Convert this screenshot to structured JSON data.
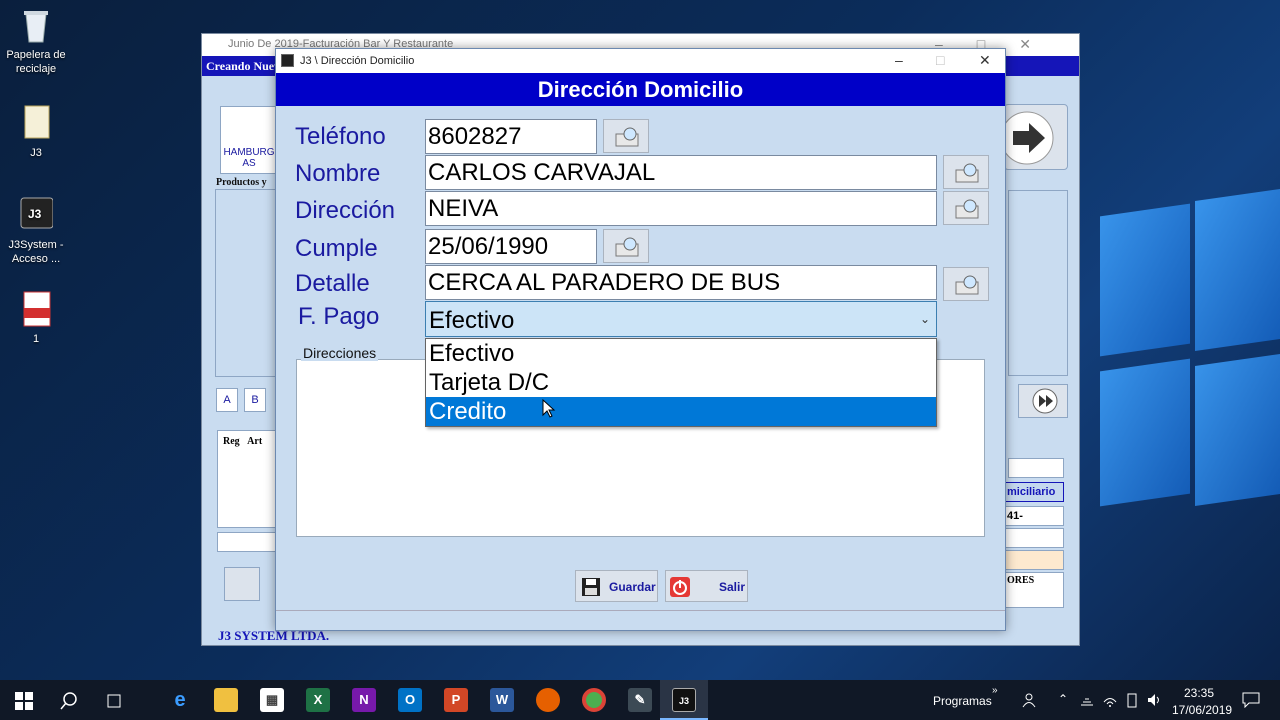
{
  "desktop": {
    "icons": [
      {
        "label": "Papelera de reciclaje"
      },
      {
        "label": "J3"
      },
      {
        "label": "J3System - Acceso ..."
      },
      {
        "label": "1"
      }
    ]
  },
  "back_window": {
    "title": "Junio De 2019-Facturación Bar Y Restaurante",
    "subtitle": "Creando Nuev",
    "product_label": "HAMBURG AS",
    "products_header": "Productos y",
    "letter_a": "A",
    "letter_b": "B",
    "col_reg": "Reg",
    "col_art": "Art",
    "right_label_1": "miciliario",
    "right_label_2": "41-",
    "right_label_3": "ORES",
    "footer": "J3 SYSTEM LTDA."
  },
  "dialog": {
    "title": "J3 \\ Dirección Domicilio",
    "header": "Dirección Domicilio",
    "labels": {
      "telefono": "Teléfono",
      "nombre": "Nombre",
      "direccion": "Dirección",
      "cumple": "Cumple",
      "detalle": "Detalle",
      "fpago": "F. Pago",
      "direcciones": "Direcciones"
    },
    "values": {
      "telefono": "8602827",
      "nombre": "CARLOS CARVAJAL",
      "direccion": "NEIVA",
      "cumple": "25/06/1990",
      "detalle": "CERCA AL PARADERO DE BUS"
    },
    "fpago_selected": "Efectivo",
    "fpago_options": [
      "Efectivo",
      "Tarjeta D/C",
      "Credito"
    ],
    "highlighted_option": "Credito",
    "save_label": "Guardar",
    "exit_label": "Salir"
  },
  "taskbar": {
    "programas": "Programas",
    "time": "23:35",
    "date": "17/06/2019"
  }
}
